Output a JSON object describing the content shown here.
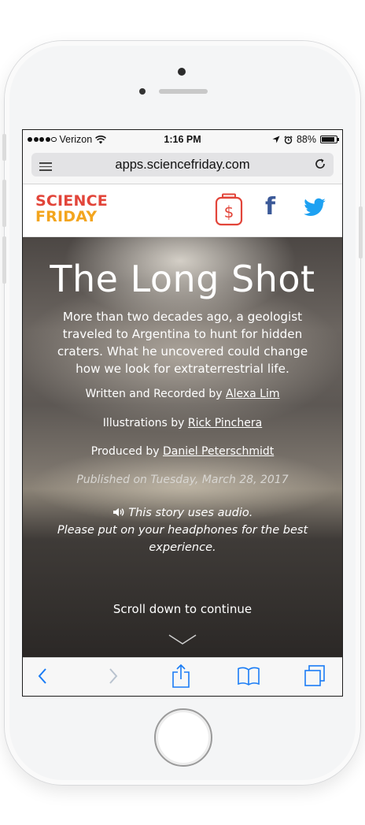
{
  "status_bar": {
    "carrier": "Verizon",
    "time": "1:16 PM",
    "battery": "88%",
    "battery_level": 0.88
  },
  "browser": {
    "url": "apps.sciencefriday.com"
  },
  "site_header": {
    "logo_line1": "SCIENCE",
    "logo_line2": "FRIDAY",
    "icons": [
      "donate-icon",
      "facebook-icon",
      "twitter-icon"
    ],
    "facebook_glyph": "f",
    "colors": {
      "logo_red": "#e2453a",
      "logo_orange": "#f3a51e",
      "facebook_blue": "#3b5998",
      "twitter_blue": "#1da1f2"
    }
  },
  "hero": {
    "title": "The Long Shot",
    "description": "More than two decades ago, a geologist traveled to Argentina to hunt for hidden craters. What he uncovered could change how we look for extraterrestrial life.",
    "written_prefix": "Written and Recorded by ",
    "written_by": "Alexa Lim",
    "illustrations_prefix": "Illustrations by ",
    "illustrations_by": "Rick Pinchera",
    "produced_prefix": "Produced by ",
    "produced_by": "Daniel Peterschmidt",
    "published": "Published on Tuesday, March 28, 2017",
    "audio_line1": "This story uses audio.",
    "audio_line2": "Please put on your headphones for the best experience.",
    "scroll_text": "Scroll down to continue"
  },
  "toolbar": {
    "icons": [
      "back-icon",
      "forward-icon",
      "share-icon",
      "bookmarks-icon",
      "tabs-icon"
    ],
    "accent": "#1a7cf5"
  }
}
